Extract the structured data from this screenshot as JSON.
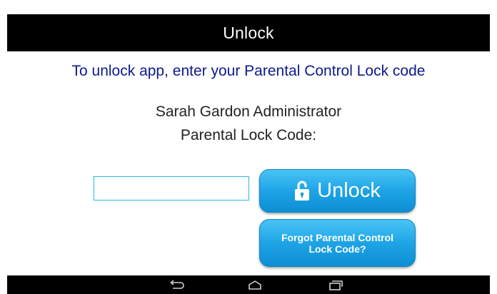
{
  "header": {
    "title": "Unlock"
  },
  "instruction": "To unlock app, enter your Parental Control Lock code",
  "user": {
    "name_line": "Sarah Gardon Administrator",
    "code_label": "Parental Lock Code:"
  },
  "code_input": {
    "value": "",
    "placeholder": ""
  },
  "unlock_button": {
    "label": "Unlock",
    "icon": "lock-open-icon"
  },
  "forgot_button": {
    "label": "Forgot Parental Control Lock Code?"
  },
  "nav": {
    "back_icon": "back-icon",
    "home_icon": "home-icon",
    "recent_icon": "recent-apps-icon"
  },
  "colors": {
    "header_bg": "#000000",
    "instruction_text": "#0d1a8c",
    "button_blue": "#1ea4e6",
    "input_border": "#29b6e6"
  }
}
